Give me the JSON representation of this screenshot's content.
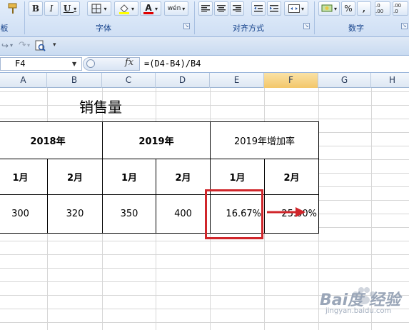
{
  "ribbon": {
    "groups": [
      {
        "label": "字体"
      },
      {
        "label": "对齐方式"
      },
      {
        "label": "数字"
      }
    ],
    "left_clip_label": "板",
    "font_buttons": {
      "bold": "B",
      "italic": "I",
      "underline": "U",
      "font_color": "A",
      "wen": "wén"
    },
    "number_buttons": {
      "percent": "%",
      "comma": ",",
      "inc_dec": ".0 .00",
      "dec_dec": ".00 .0"
    }
  },
  "namebox": {
    "value": "F4"
  },
  "formula_bar": {
    "fx": "fx",
    "formula": "=(D4-B4)/B4"
  },
  "columns": [
    "A",
    "B",
    "C",
    "D",
    "E",
    "F",
    "G",
    "H"
  ],
  "sheet": {
    "title": "销售量",
    "years": [
      "2018年",
      "2019年"
    ],
    "rate_header": "2019年增加率",
    "months": [
      "1月",
      "2月",
      "1月",
      "2月",
      "1月",
      "2月"
    ],
    "values": [
      "300",
      "320",
      "350",
      "400",
      "16.67%",
      "25.00%"
    ]
  },
  "watermark": {
    "text": "Bai度 经验",
    "url": "jingyan.baidu.com"
  },
  "colors": {
    "highlight": "#d0262b",
    "ribbon_text": "#15428b"
  }
}
